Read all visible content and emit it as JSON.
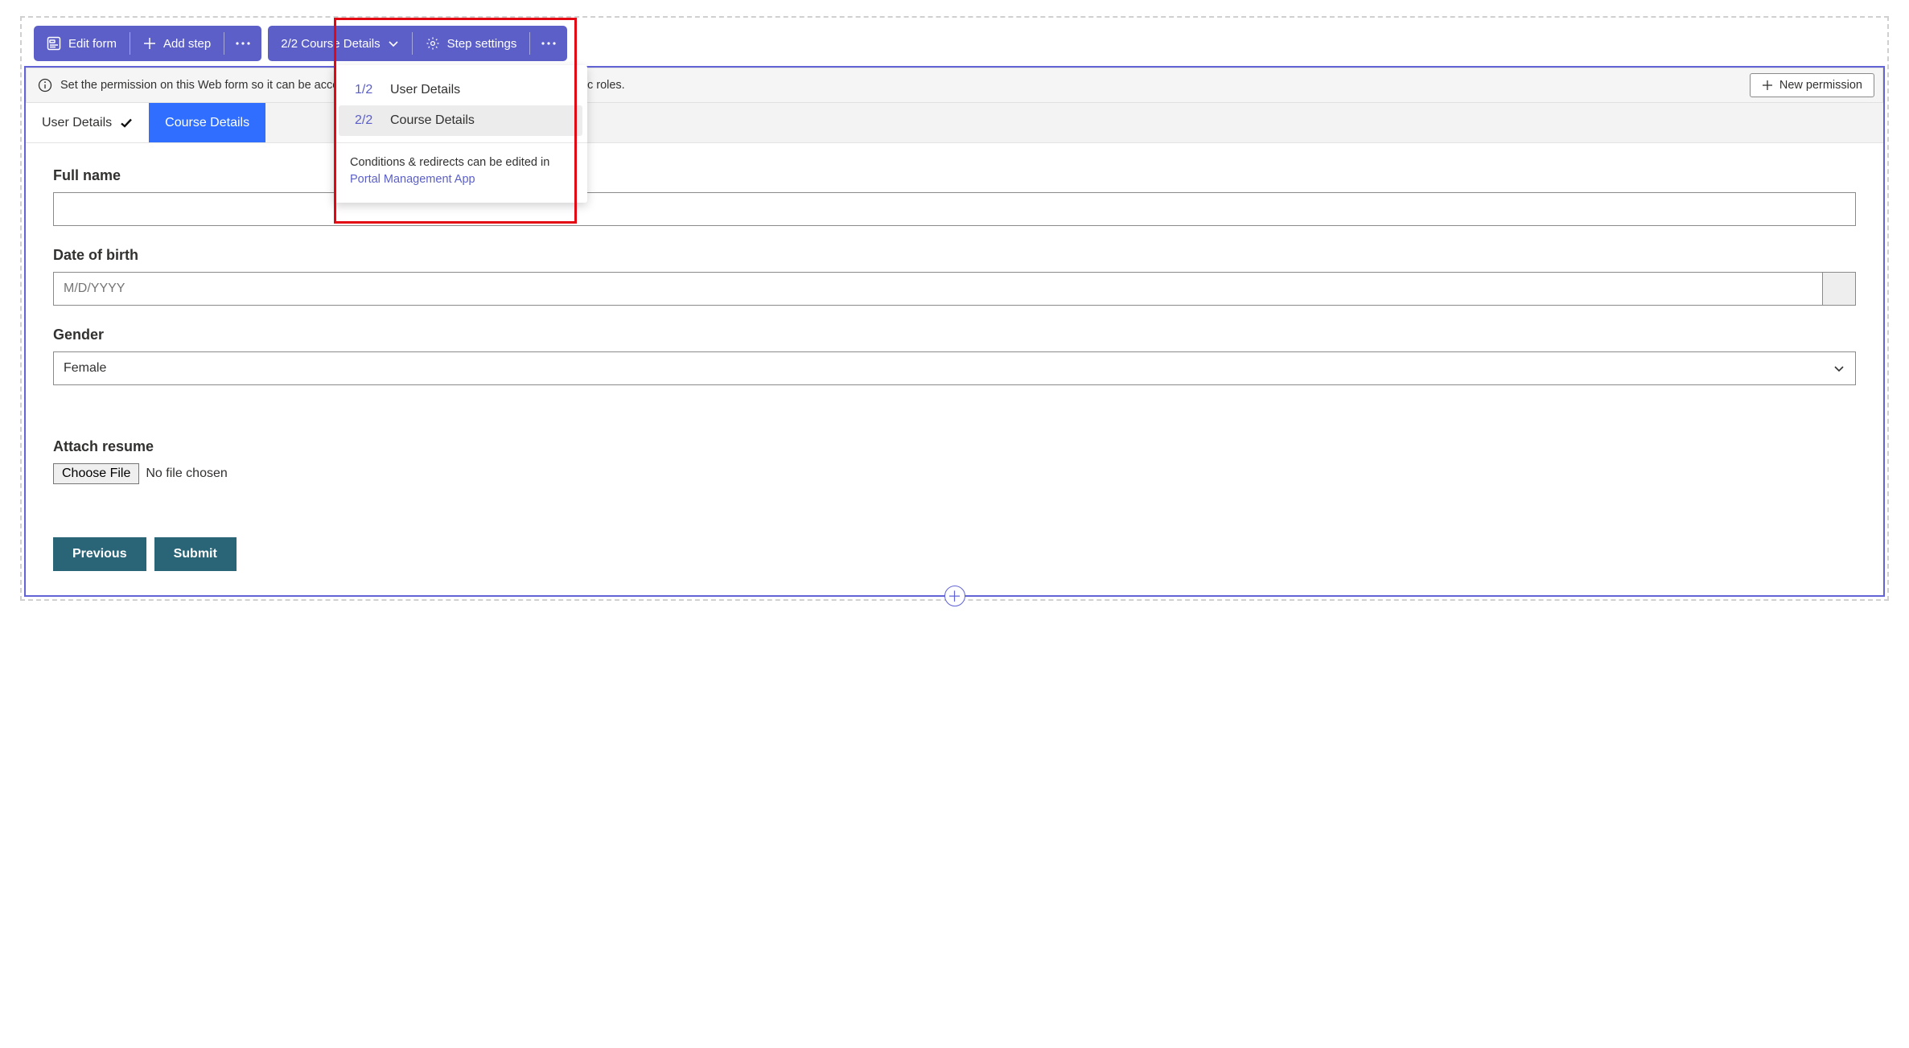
{
  "toolbar": {
    "edit_form": "Edit form",
    "add_step": "Add step",
    "step_indicator": "2/2 Course Details",
    "step_settings": "Step settings"
  },
  "dropdown": {
    "items": [
      {
        "index": "1/2",
        "label": "User Details"
      },
      {
        "index": "2/2",
        "label": "Course Details"
      }
    ],
    "footer_text": "Conditions & redirects can be edited in",
    "footer_link": "Portal Management App"
  },
  "info_banner": {
    "text": "Set the permission on this Web form so it can be accessed by anyone, or limit the interaction to specific roles.",
    "button": "New permission"
  },
  "tabs": [
    {
      "label": "User Details",
      "completed": true,
      "active": false
    },
    {
      "label": "Course Details",
      "completed": false,
      "active": true
    }
  ],
  "form": {
    "full_name": {
      "label": "Full name",
      "value": ""
    },
    "dob": {
      "label": "Date of birth",
      "placeholder": "M/D/YYYY"
    },
    "gender": {
      "label": "Gender",
      "value": "Female"
    },
    "attach": {
      "label": "Attach resume",
      "button": "Choose File",
      "status": "No file chosen"
    },
    "previous": "Previous",
    "submit": "Submit"
  }
}
